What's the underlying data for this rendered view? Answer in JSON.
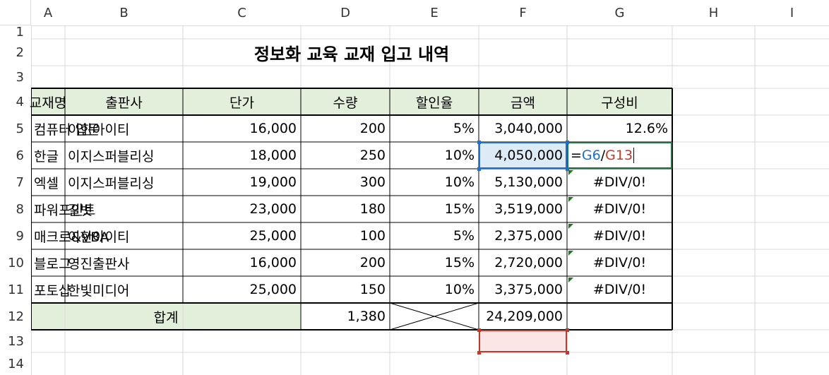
{
  "columns": [
    "A",
    "B",
    "C",
    "D",
    "E",
    "F",
    "G",
    "H",
    "I"
  ],
  "rows": [
    "1",
    "2",
    "3",
    "4",
    "5",
    "6",
    "7",
    "8",
    "9",
    "10",
    "11",
    "12",
    "13",
    "14"
  ],
  "title": "정보화 교육 교재 입고 내역",
  "headers": [
    "교재명",
    "출판사",
    "단가",
    "수량",
    "할인율",
    "금액",
    "구성비"
  ],
  "data_rows": [
    {
      "name": "컴퓨터 입문",
      "publisher": "이한아이티",
      "price": "16,000",
      "qty": "200",
      "discount": "5%",
      "amount": "3,040,000",
      "ratio": "12.6%"
    },
    {
      "name": "한글",
      "publisher": "이지스퍼블리싱",
      "price": "18,000",
      "qty": "250",
      "discount": "10%",
      "amount": "4,050,000",
      "ratio": ""
    },
    {
      "name": "엑셀",
      "publisher": "이지스퍼블리싱",
      "price": "19,000",
      "qty": "300",
      "discount": "10%",
      "amount": "5,130,000",
      "ratio": "#DIV/0!"
    },
    {
      "name": "파워포인트",
      "publisher": "길벗",
      "price": "23,000",
      "qty": "180",
      "discount": "15%",
      "amount": "3,519,000",
      "ratio": "#DIV/0!"
    },
    {
      "name": "매크로&VBA",
      "publisher": "이한아이티",
      "price": "25,000",
      "qty": "100",
      "discount": "5%",
      "amount": "2,375,000",
      "ratio": "#DIV/0!"
    },
    {
      "name": "블로그",
      "publisher": "영진출판사",
      "price": "16,000",
      "qty": "200",
      "discount": "15%",
      "amount": "2,720,000",
      "ratio": "#DIV/0!"
    },
    {
      "name": "포토샵",
      "publisher": "한빛미디어",
      "price": "25,000",
      "qty": "150",
      "discount": "10%",
      "amount": "3,375,000",
      "ratio": "#DIV/0!"
    }
  ],
  "total": {
    "label": "합계",
    "qty": "1,380",
    "amount": "24,209,000"
  },
  "editing": {
    "eq": "=",
    "ref1": "G6",
    "slash": "/",
    "ref2": "G13"
  },
  "colors": {
    "header_fill": "#e2efda",
    "ref1": "#1e6fd0",
    "ref2": "#c0392b",
    "ref1_fill": "#ddebf7",
    "ref2_fill": "#fbe5e5",
    "active": "#217346",
    "error_triangle": "#1f7a1f"
  }
}
